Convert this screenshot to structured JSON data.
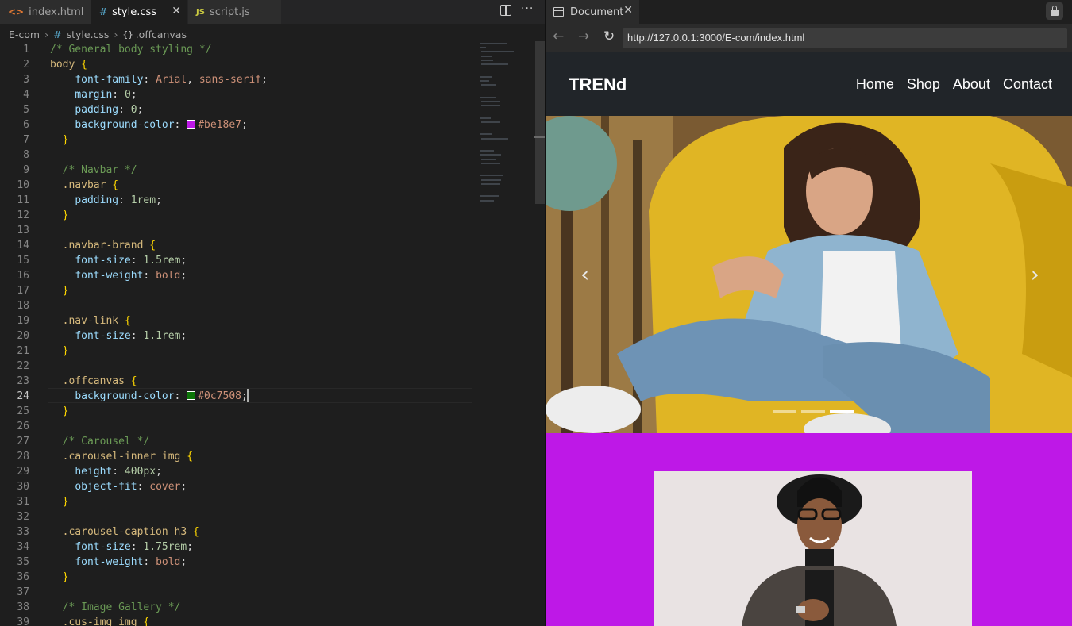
{
  "editor": {
    "tabs": [
      {
        "label": "index.html",
        "icon": "html-file-icon"
      },
      {
        "label": "style.css",
        "icon": "css-file-icon",
        "active": true
      },
      {
        "label": "script.js",
        "icon": "js-file-icon"
      }
    ],
    "tab_icon_text": {
      "html": "<>",
      "css": "#",
      "js": "JS"
    },
    "breadcrumb": [
      "E-com",
      "style.css",
      ".offcanvas"
    ],
    "cursor_line": 24,
    "lines": [
      {
        "n": "1",
        "t": "/* General body styling */"
      },
      {
        "n": "2",
        "t": "body {"
      },
      {
        "n": "3",
        "t": "  font-family: Arial, sans-serif;"
      },
      {
        "n": "4",
        "t": "  margin: 0;"
      },
      {
        "n": "5",
        "t": "  padding: 0;"
      },
      {
        "n": "6",
        "t": "  background-color: #be18e7;"
      },
      {
        "n": "7",
        "t": "}"
      },
      {
        "n": "8",
        "t": ""
      },
      {
        "n": "9",
        "t": "/* Navbar */"
      },
      {
        "n": "10",
        "t": ".navbar {"
      },
      {
        "n": "11",
        "t": "  padding: 1rem;"
      },
      {
        "n": "12",
        "t": "}"
      },
      {
        "n": "13",
        "t": ""
      },
      {
        "n": "14",
        "t": ".navbar-brand {"
      },
      {
        "n": "15",
        "t": "  font-size: 1.5rem;"
      },
      {
        "n": "16",
        "t": "  font-weight: bold;"
      },
      {
        "n": "17",
        "t": "}"
      },
      {
        "n": "18",
        "t": ""
      },
      {
        "n": "19",
        "t": ".nav-link {"
      },
      {
        "n": "20",
        "t": "  font-size: 1.1rem;"
      },
      {
        "n": "21",
        "t": "}"
      },
      {
        "n": "22",
        "t": ""
      },
      {
        "n": "23",
        "t": ".offcanvas {"
      },
      {
        "n": "24",
        "t": "  background-color: #0c7508;"
      },
      {
        "n": "25",
        "t": "}"
      },
      {
        "n": "26",
        "t": ""
      },
      {
        "n": "27",
        "t": "/* Carousel */"
      },
      {
        "n": "28",
        "t": ".carousel-inner img {"
      },
      {
        "n": "29",
        "t": "  height: 400px;"
      },
      {
        "n": "30",
        "t": "  object-fit: cover;"
      },
      {
        "n": "31",
        "t": "}"
      },
      {
        "n": "32",
        "t": ""
      },
      {
        "n": "33",
        "t": ".carousel-caption h3 {"
      },
      {
        "n": "34",
        "t": "  font-size: 1.75rem;"
      },
      {
        "n": "35",
        "t": "  font-weight: bold;"
      },
      {
        "n": "36",
        "t": "}"
      },
      {
        "n": "37",
        "t": ""
      },
      {
        "n": "38",
        "t": "/* Image Gallery */"
      },
      {
        "n": "39",
        "t": ".cus-img img {"
      }
    ]
  },
  "browser": {
    "tab_title": "Document",
    "url": "http://127.0.0.1:3000/E-com/index.html",
    "site": {
      "brand": "TRENd",
      "nav_links": [
        "Home",
        "Shop",
        "About",
        "Contact"
      ],
      "carousel_indicators": 3,
      "active_indicator": 2,
      "background_color": "#be18e7",
      "navbar_color": "#212529"
    }
  },
  "colors": {
    "swatch_body_bg": "#be18e7",
    "swatch_offcanvas": "#0c7508"
  }
}
